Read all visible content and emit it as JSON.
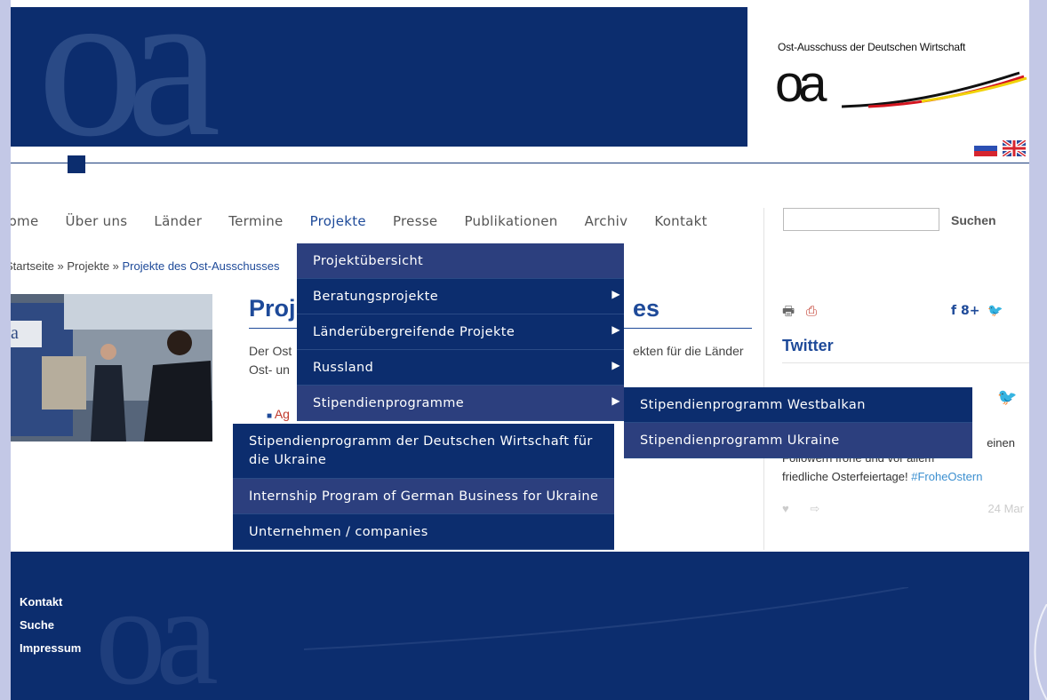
{
  "header": {
    "logo_caption": "Ost-Ausschuss der Deutschen Wirtschaft",
    "logo_mark": "oa",
    "banner_watermark": "oa",
    "flags": [
      "flag-russia-icon",
      "flag-uk-icon"
    ]
  },
  "nav": {
    "items": [
      "Home",
      "Über uns",
      "Länder",
      "Termine",
      "Projekte",
      "Presse",
      "Publikationen",
      "Archiv",
      "Kontakt"
    ],
    "search_button": "Suchen",
    "search_placeholder": ""
  },
  "breadcrumb": {
    "prefix": "Startseite » Projekte » ",
    "current": "Projekte des Ost-Ausschusses"
  },
  "content": {
    "title_start": "Proj",
    "title_end": "es",
    "line1_start": "Der Ost",
    "line1_end": "ekten für die Länder",
    "line2_start": "Ost- un",
    "bullet_text": "Ag"
  },
  "dropdown": {
    "main": [
      {
        "label": "Projektübersicht",
        "arrow": false
      },
      {
        "label": "Beratungsprojekte",
        "arrow": true
      },
      {
        "label": "Länderübergreifende Projekte",
        "arrow": true
      },
      {
        "label": "Russland",
        "arrow": true
      },
      {
        "label": "Stipendienprogramme",
        "arrow": true
      }
    ],
    "stipendien_sub": [
      {
        "label": "Stipendienprogramm Westbalkan",
        "arrow": false
      },
      {
        "label": "Stipendienprogramm Ukraine",
        "arrow": true
      }
    ],
    "ukraine_sub": [
      {
        "label": "Stipendienprogramm der Deutschen Wirtschaft für die Ukraine"
      },
      {
        "label": "Internship Program of German Business for Ukraine"
      },
      {
        "label": "Unternehmen / companies"
      }
    ],
    "arrow_glyph": "▶"
  },
  "sidebar": {
    "twitter_title": "Twitter",
    "social": "f  8+",
    "tweet_partial_end": "einen",
    "tweet_line2": "Followern frohe und vor allem",
    "tweet_line3_start": "friedliche Osterfeiertage! ",
    "tweet_hashtag": "#FroheOstern",
    "tweet_date": "24 Mar"
  },
  "footer": {
    "links": [
      "Kontakt",
      "Suche",
      "Impressum"
    ],
    "watermark": "oa"
  },
  "colors": {
    "brand_dark": "#0c2d6e",
    "menu_highlight": "#2c3f7e",
    "link_blue": "#1e4a99",
    "outer_bg": "#c3c8e6"
  }
}
